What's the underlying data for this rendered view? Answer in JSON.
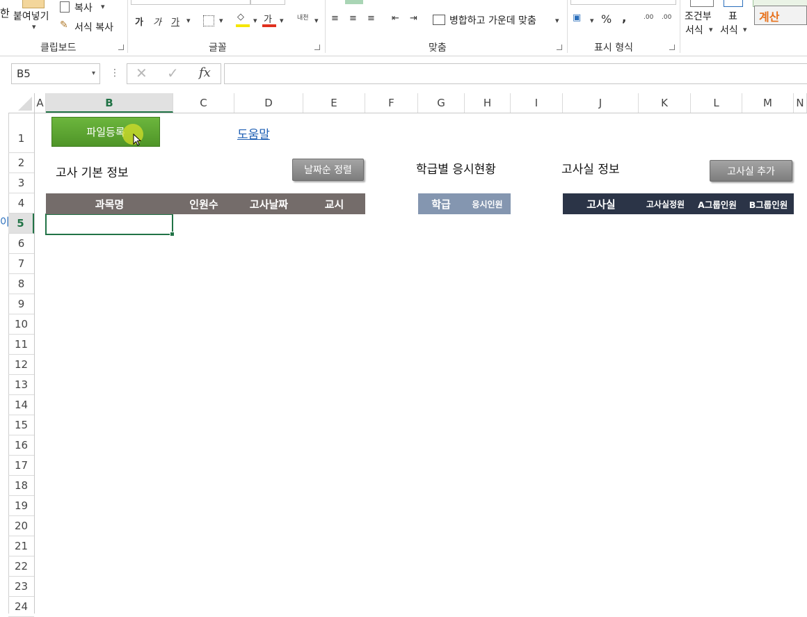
{
  "ribbon": {
    "clipboard": {
      "paste": "붙여넣기",
      "copy": "복사",
      "format_painter": "서식 복사",
      "group": "클립보드"
    },
    "font": {
      "bold": "가",
      "italic": "가",
      "underline": "가",
      "font_color": "가",
      "phonetic": "내천",
      "group": "글꼴"
    },
    "alignment": {
      "merge_center": "병합하고 가운데 맞춤",
      "group": "맞춤"
    },
    "number": {
      "percent": "%",
      "comma": ",",
      "inc_decimal": ".00",
      "dec_decimal": ".00",
      "group": "표시 형식"
    },
    "styles": {
      "conditional_top": "조건부",
      "conditional_bottom": "서식",
      "table_top": "표",
      "table_bottom": "서식",
      "calc_style": "계산"
    }
  },
  "formula_bar": {
    "name_box": "B5",
    "fx": "fx",
    "formula": ""
  },
  "columns": [
    "A",
    "B",
    "C",
    "D",
    "E",
    "F",
    "G",
    "H",
    "I",
    "J",
    "K",
    "L",
    "M",
    "N"
  ],
  "selected_column": "B",
  "rows": [
    "1",
    "2",
    "3",
    "4",
    "5",
    "6",
    "7",
    "8",
    "9",
    "10",
    "11",
    "12",
    "13",
    "14",
    "15",
    "16",
    "17",
    "18",
    "19",
    "20",
    "21",
    "22",
    "23",
    "24"
  ],
  "selected_row": "5",
  "active_cell": "B5",
  "sheet": {
    "file_register_btn": "파일등록",
    "help_link": "도움말",
    "exam_info_title": "고사 기본 정보",
    "sort_by_date_btn": "날짜순 정렬",
    "class_status_title": "학급별 응시현황",
    "room_info_title": "고사실 정보",
    "add_room_btn": "고사실 추가",
    "exam_table_headers": [
      "과목명",
      "인원수",
      "고사날짜",
      "교시"
    ],
    "class_table_headers": [
      "학급",
      "응시인원"
    ],
    "room_table_headers": [
      "고사실",
      "고사실정원",
      "A그룹인원",
      "B그룹인원"
    ]
  },
  "colors": {
    "excel_green": "#217346",
    "exam_header_bg": "#746c6a",
    "class_header_bg": "#8496b0",
    "room_header_bg": "#2b3447",
    "file_btn_bg": "#5fa832",
    "calc_text": "#e7711b"
  }
}
